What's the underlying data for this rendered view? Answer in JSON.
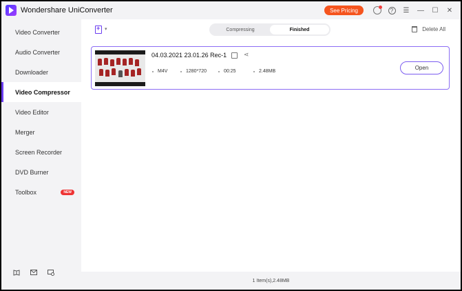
{
  "app": {
    "title": "Wondershare UniConverter"
  },
  "titlebar": {
    "pricing_label": "See Pricing",
    "icons": [
      "avatar-icon",
      "help-icon",
      "menu-icon",
      "minimize-icon",
      "maximize-icon",
      "close-icon"
    ]
  },
  "sidebar": {
    "items": [
      {
        "label": "Video Converter"
      },
      {
        "label": "Audio Converter"
      },
      {
        "label": "Downloader"
      },
      {
        "label": "Video Compressor",
        "active": true
      },
      {
        "label": "Video Editor"
      },
      {
        "label": "Merger"
      },
      {
        "label": "Screen Recorder"
      },
      {
        "label": "DVD Burner"
      },
      {
        "label": "Toolbox",
        "badge": "NEW"
      }
    ],
    "bottom_icons": [
      "book-icon",
      "mail-icon",
      "feedback-icon"
    ]
  },
  "toolbar": {
    "tabs": [
      {
        "label": "Compressing",
        "active": false
      },
      {
        "label": "Finished",
        "active": true
      }
    ],
    "delete_all_label": "Delete All"
  },
  "file": {
    "name": "04.03.2021 23.01.26 Rec-1",
    "format": "M4V",
    "resolution": "1280*720",
    "duration": "00:25",
    "size": "2.48MB",
    "open_label": "Open"
  },
  "status": {
    "text": "1 Item(s),2.48MB"
  },
  "colors": {
    "accent": "#6a3cf0",
    "pricing": "#f5541e",
    "new_badge": "#ee3333"
  }
}
